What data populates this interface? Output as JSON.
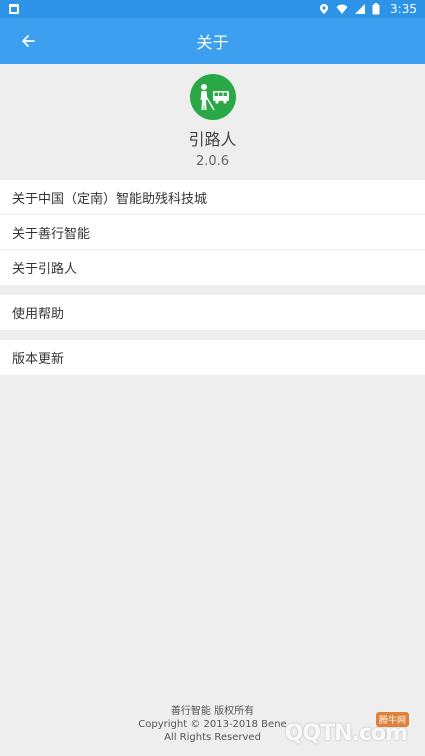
{
  "status_bar": {
    "time": "3:35"
  },
  "app_bar": {
    "title": "关于"
  },
  "header": {
    "app_name": "引路人",
    "version": "2.0.6"
  },
  "group1": [
    {
      "label": "关于中国（定南）智能助残科技城"
    },
    {
      "label": "关于善行智能"
    },
    {
      "label": "关于引路人"
    }
  ],
  "group2": [
    {
      "label": "使用帮助"
    }
  ],
  "group3": [
    {
      "label": "版本更新"
    }
  ],
  "footer": {
    "line1": "善行智能 版权所有",
    "line2": "Copyright © 2013-2018 Bene",
    "line3": "All Rights Reserved"
  },
  "watermark": {
    "text": "QQTN.com",
    "badge": "腾牛网"
  },
  "colors": {
    "app_bar": "#3c9ff0",
    "status_bar": "#2c93e6",
    "logo_bg": "#2aa845"
  },
  "icons": [
    "back-arrow-icon",
    "wifi-icon",
    "signal-icon",
    "battery-icon",
    "location-icon",
    "notification-icon"
  ]
}
